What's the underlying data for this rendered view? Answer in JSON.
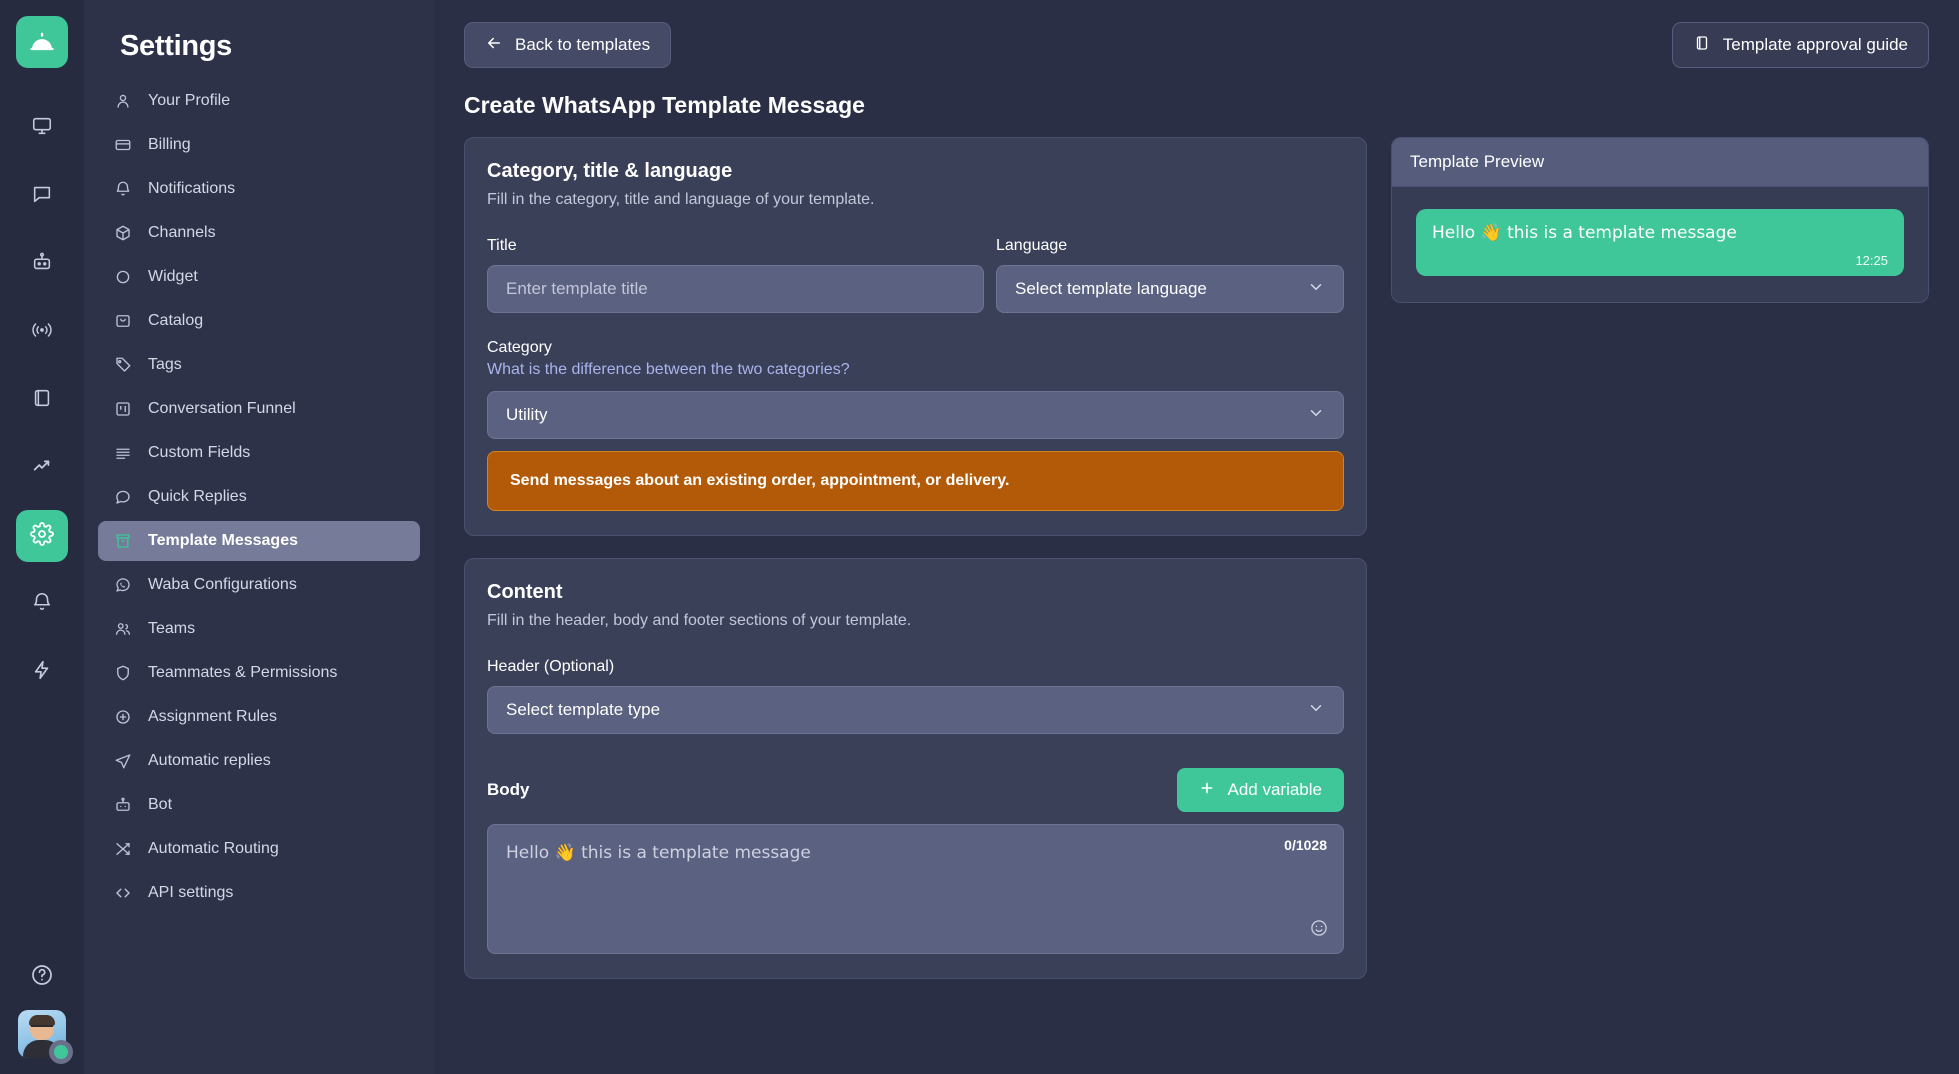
{
  "rail": {
    "logo_icon": "bell-service-logo",
    "items": [
      {
        "name": "monitor-icon",
        "label": "Dashboard"
      },
      {
        "name": "chat-icon",
        "label": "Conversations"
      },
      {
        "name": "bot-icon",
        "label": "Bot"
      },
      {
        "name": "broadcast-icon",
        "label": "Broadcast"
      },
      {
        "name": "book-icon",
        "label": "Knowledge"
      },
      {
        "name": "trending-up-icon",
        "label": "Reports"
      },
      {
        "name": "gear-icon",
        "label": "Settings"
      },
      {
        "name": "bell-icon",
        "label": "Notifications"
      },
      {
        "name": "lightning-icon",
        "label": "Automations"
      }
    ],
    "help_icon": "help-circle-icon",
    "avatar_status": "online"
  },
  "sidebar": {
    "title": "Settings",
    "items": [
      {
        "label": "Your Profile",
        "icon": "user-icon"
      },
      {
        "label": "Billing",
        "icon": "credit-card-icon"
      },
      {
        "label": "Notifications",
        "icon": "bell-icon"
      },
      {
        "label": "Channels",
        "icon": "box-icon"
      },
      {
        "label": "Widget",
        "icon": "circle-icon"
      },
      {
        "label": "Catalog",
        "icon": "bag-icon"
      },
      {
        "label": "Tags",
        "icon": "tag-icon"
      },
      {
        "label": "Conversation Funnel",
        "icon": "kanban-icon"
      },
      {
        "label": "Custom Fields",
        "icon": "lines-icon"
      },
      {
        "label": "Quick Replies",
        "icon": "message-icon"
      },
      {
        "label": "Template Messages",
        "icon": "archive-icon"
      },
      {
        "label": "Waba Configurations",
        "icon": "whatsapp-icon"
      },
      {
        "label": "Teams",
        "icon": "users-icon"
      },
      {
        "label": "Teammates & Permissions",
        "icon": "shield-icon"
      },
      {
        "label": "Assignment Rules",
        "icon": "plus-circle-icon"
      },
      {
        "label": "Automatic replies",
        "icon": "send-icon"
      },
      {
        "label": "Bot",
        "icon": "bot-icon"
      },
      {
        "label": "Automatic Routing",
        "icon": "shuffle-icon"
      },
      {
        "label": "API settings",
        "icon": "code-icon"
      }
    ],
    "active_index": 10
  },
  "topbar": {
    "back_label": "Back to templates",
    "back_icon": "arrow-left-icon",
    "guide_label": "Template approval guide",
    "guide_icon": "book-icon"
  },
  "page": {
    "title": "Create WhatsApp Template Message"
  },
  "category_card": {
    "title": "Category, title & language",
    "subtitle": "Fill in the category, title and language of your template.",
    "title_field": {
      "label": "Title",
      "value": "",
      "placeholder": "Enter template title"
    },
    "language_field": {
      "label": "Language",
      "value": "Select template language",
      "chevron_icon": "chevron-down-icon"
    },
    "category_field": {
      "label": "Category",
      "help_link": "What is the difference between the two categories?",
      "value": "Utility",
      "chevron_icon": "chevron-down-icon"
    },
    "alert": {
      "text": "Send messages about an existing order, appointment, or delivery.",
      "bg_color": "#b35a08",
      "border_color": "#d4831e"
    }
  },
  "content_card": {
    "title": "Content",
    "subtitle": "Fill in the header, body and footer sections of your template.",
    "header_field": {
      "label": "Header (Optional)",
      "value": "Select template type",
      "chevron_icon": "chevron-down-icon"
    },
    "body_field": {
      "label": "Body",
      "add_variable_label": "Add variable",
      "add_variable_icon": "plus-icon",
      "text": "Hello 👋 this is a template message",
      "counter": "0/1028",
      "emoji_icon": "smiley-icon"
    }
  },
  "preview": {
    "title": "Template Preview",
    "message": "Hello 👋 this is a template message",
    "time": "12:25",
    "bubble_color": "#3fc79a"
  },
  "theme": {
    "accent": "#3fc79a",
    "bg": "#2b2f45",
    "card": "#3b4059",
    "rail": "#272b40",
    "nav": "#2e3249",
    "link": "#a9b4ec"
  }
}
